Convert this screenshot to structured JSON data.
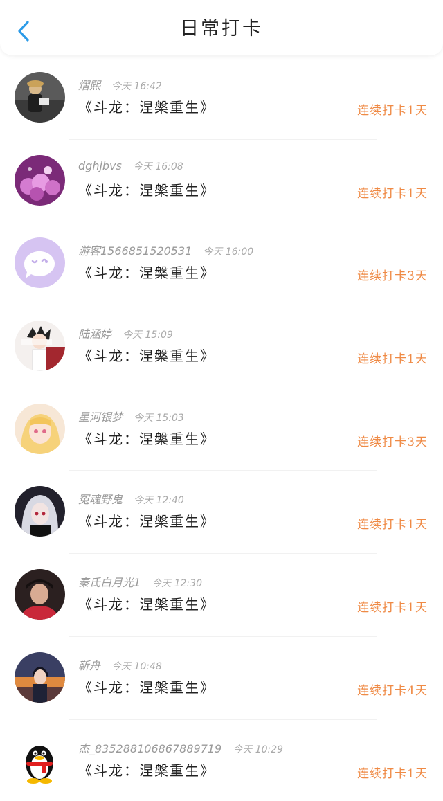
{
  "header": {
    "title": "日常打卡"
  },
  "colors": {
    "accent": "#ef8a45",
    "back": "#2c9be8"
  },
  "entries": [
    {
      "name": "熠熙",
      "time": "今天 16:42",
      "game": "《斗龙：涅槃重生》",
      "streak": "连续打卡1天",
      "avatar": "user-photo-dark"
    },
    {
      "name": "dghjbvs",
      "time": "今天 16:08",
      "game": "《斗龙：涅槃重生》",
      "streak": "连续打卡1天",
      "avatar": "purple-flowers"
    },
    {
      "name": "游客1566851520531",
      "time": "今天 16:00",
      "game": "《斗龙：涅槃重生》",
      "streak": "连续打卡3天",
      "avatar": "default-chat-icon"
    },
    {
      "name": "陆涵婷",
      "time": "今天 15:09",
      "game": "《斗龙：涅槃重生》",
      "streak": "连续打卡1天",
      "avatar": "anime-character"
    },
    {
      "name": "星河银梦",
      "time": "今天 15:03",
      "game": "《斗龙：涅槃重生》",
      "streak": "连续打卡3天",
      "avatar": "anime-girl-blonde"
    },
    {
      "name": "冤魂野鬼",
      "time": "今天 12:40",
      "game": "《斗龙：涅槃重生》",
      "streak": "连续打卡1天",
      "avatar": "anime-girl-dark"
    },
    {
      "name": "秦氏白月光1",
      "time": "今天 12:30",
      "game": "《斗龙：涅槃重生》",
      "streak": "连续打卡1天",
      "avatar": "user-photo-red"
    },
    {
      "name": "靳舟",
      "time": "今天 10:48",
      "game": "《斗龙：涅槃重生》",
      "streak": "连续打卡4天",
      "avatar": "anime-boy-sunset"
    },
    {
      "name": "杰_835288106867889719",
      "time": "今天 10:29",
      "game": "《斗龙：涅槃重生》",
      "streak": "连续打卡1天",
      "avatar": "qq-penguin"
    }
  ]
}
